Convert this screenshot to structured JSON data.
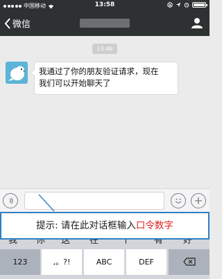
{
  "status_bar": {
    "carrier": "中国移动",
    "time": "13:58"
  },
  "nav": {
    "back_label": "微信"
  },
  "chat": {
    "timestamp": "13:46",
    "message_line1": "我通过了你的朋友验证请求，现在",
    "message_line2": "我们可以开始聊天了"
  },
  "hint": {
    "prefix": "提示: 请在此对话框输入",
    "highlight": "口令数字"
  },
  "keyboard": {
    "candidates": [
      "我",
      "你",
      "这",
      "在",
      "个",
      "有",
      "好"
    ],
    "keys": [
      "123",
      ",。?!",
      "ABC",
      "DEF"
    ]
  },
  "colors": {
    "header": "#2e3132",
    "hint_border": "#2f7fc1",
    "hint_highlight": "#e02020",
    "avatar": "#5cb4d8"
  }
}
